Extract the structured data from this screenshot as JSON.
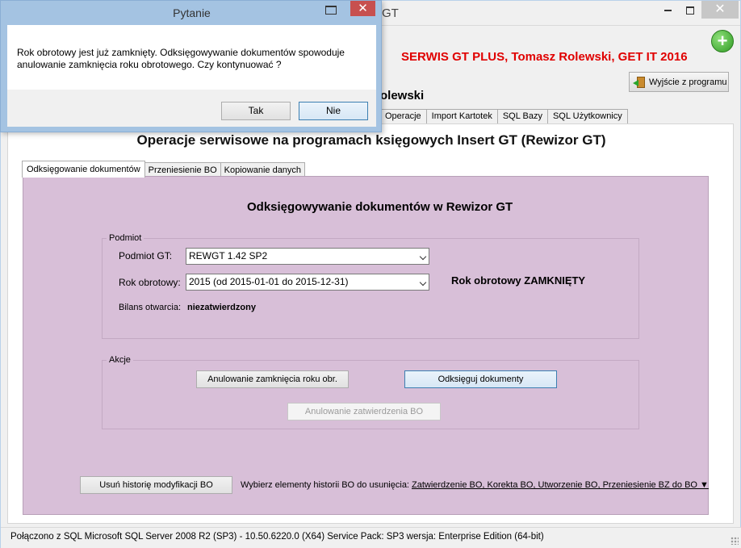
{
  "main": {
    "title_partial": "GT",
    "brand": "SERWIS GT PLUS, Tomasz Rolewski, GET IT 2016",
    "exit_label": "Wyjście z programu",
    "user_partial": "olewski",
    "top_tabs": [
      "Operacje",
      "Import Kartotek",
      "SQL Bazy",
      "SQL Użytkownicy"
    ],
    "section_title": "Operacje serwisowe na programach księgowych  Insert GT (Rewizor GT)",
    "sub_tabs": [
      "Odksięgowanie dokumentów",
      "Przeniesienie BO",
      "Kopiowanie danych"
    ],
    "active_sub_tab": "Odksięgowanie dokumentów"
  },
  "content": {
    "title": "Odksięgowywanie dokumentów w Rewizor GT",
    "podmiot_group": {
      "label": "Podmiot",
      "podmiot_label": "Podmiot GT:",
      "podmiot_value": "REWGT 1.42 SP2",
      "rok_label": "Rok obrotowy:",
      "rok_value": "2015 (od 2015-01-01 do 2015-12-31)",
      "rok_status": "Rok obrotowy ZAMKNIĘTY",
      "bilans_label": "Bilans otwarcia:",
      "bilans_value": "niezatwierdzony"
    },
    "akcje_group": {
      "label": "Akcje",
      "btn_anuluj_zamkniecie": "Anulowanie zamknięcia roku obr.",
      "btn_odksieguj": "Odksięguj dokumenty",
      "btn_anuluj_bo": "Anulowanie zatwierdzenia BO"
    },
    "history": {
      "btn_usun": "Usuń historię modyfikacji BO",
      "select_label": "Wybierz elementy historii BO do usunięcia:",
      "select_value": "Zatwierdzenie BO, Korekta BO, Utworzenie BO, Przeniesienie BZ do BO ▼"
    }
  },
  "statusbar": {
    "text": "Połączono z SQL  Microsoft SQL Server 2008 R2 (SP3) - 10.50.6220.0 (X64)  Service Pack: SP3  wersja: Enterprise Edition (64-bit)"
  },
  "dialog": {
    "title": "Pytanie",
    "message": "Rok obrotowy jest już zamknięty. Odksięgowywanie dokumentów spowoduje anulowanie zamknięcia roku obrotowego. Czy kontynuować ?",
    "yes_label": "Tak",
    "no_label": "Nie"
  }
}
